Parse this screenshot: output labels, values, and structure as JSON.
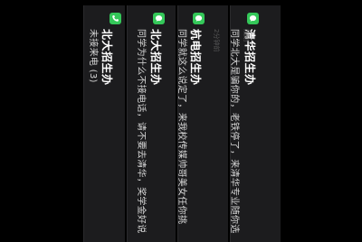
{
  "notifications": [
    {
      "title": "北大招生办",
      "message": "未接来电 (3)",
      "icon": "phone-icon",
      "meta": ""
    },
    {
      "title": "北大招生办",
      "message": "同学为什么不接电话，请不要去清华，奖学金好说",
      "icon": "message-icon",
      "meta": ""
    },
    {
      "title": "杭电招生办",
      "message": "同学就这么说定了，来我校传媒帅哥美女任你挑",
      "icon": "message-icon",
      "meta": "2分钟前"
    },
    {
      "title": "清华招生办",
      "message": "同学北大是骗你的，老铁停了，来清华专业随你选",
      "icon": "message-icon",
      "meta": "刚刚"
    }
  ],
  "colors": {
    "icon_green": "#34c759",
    "card_bg": "#1c1c1e"
  }
}
